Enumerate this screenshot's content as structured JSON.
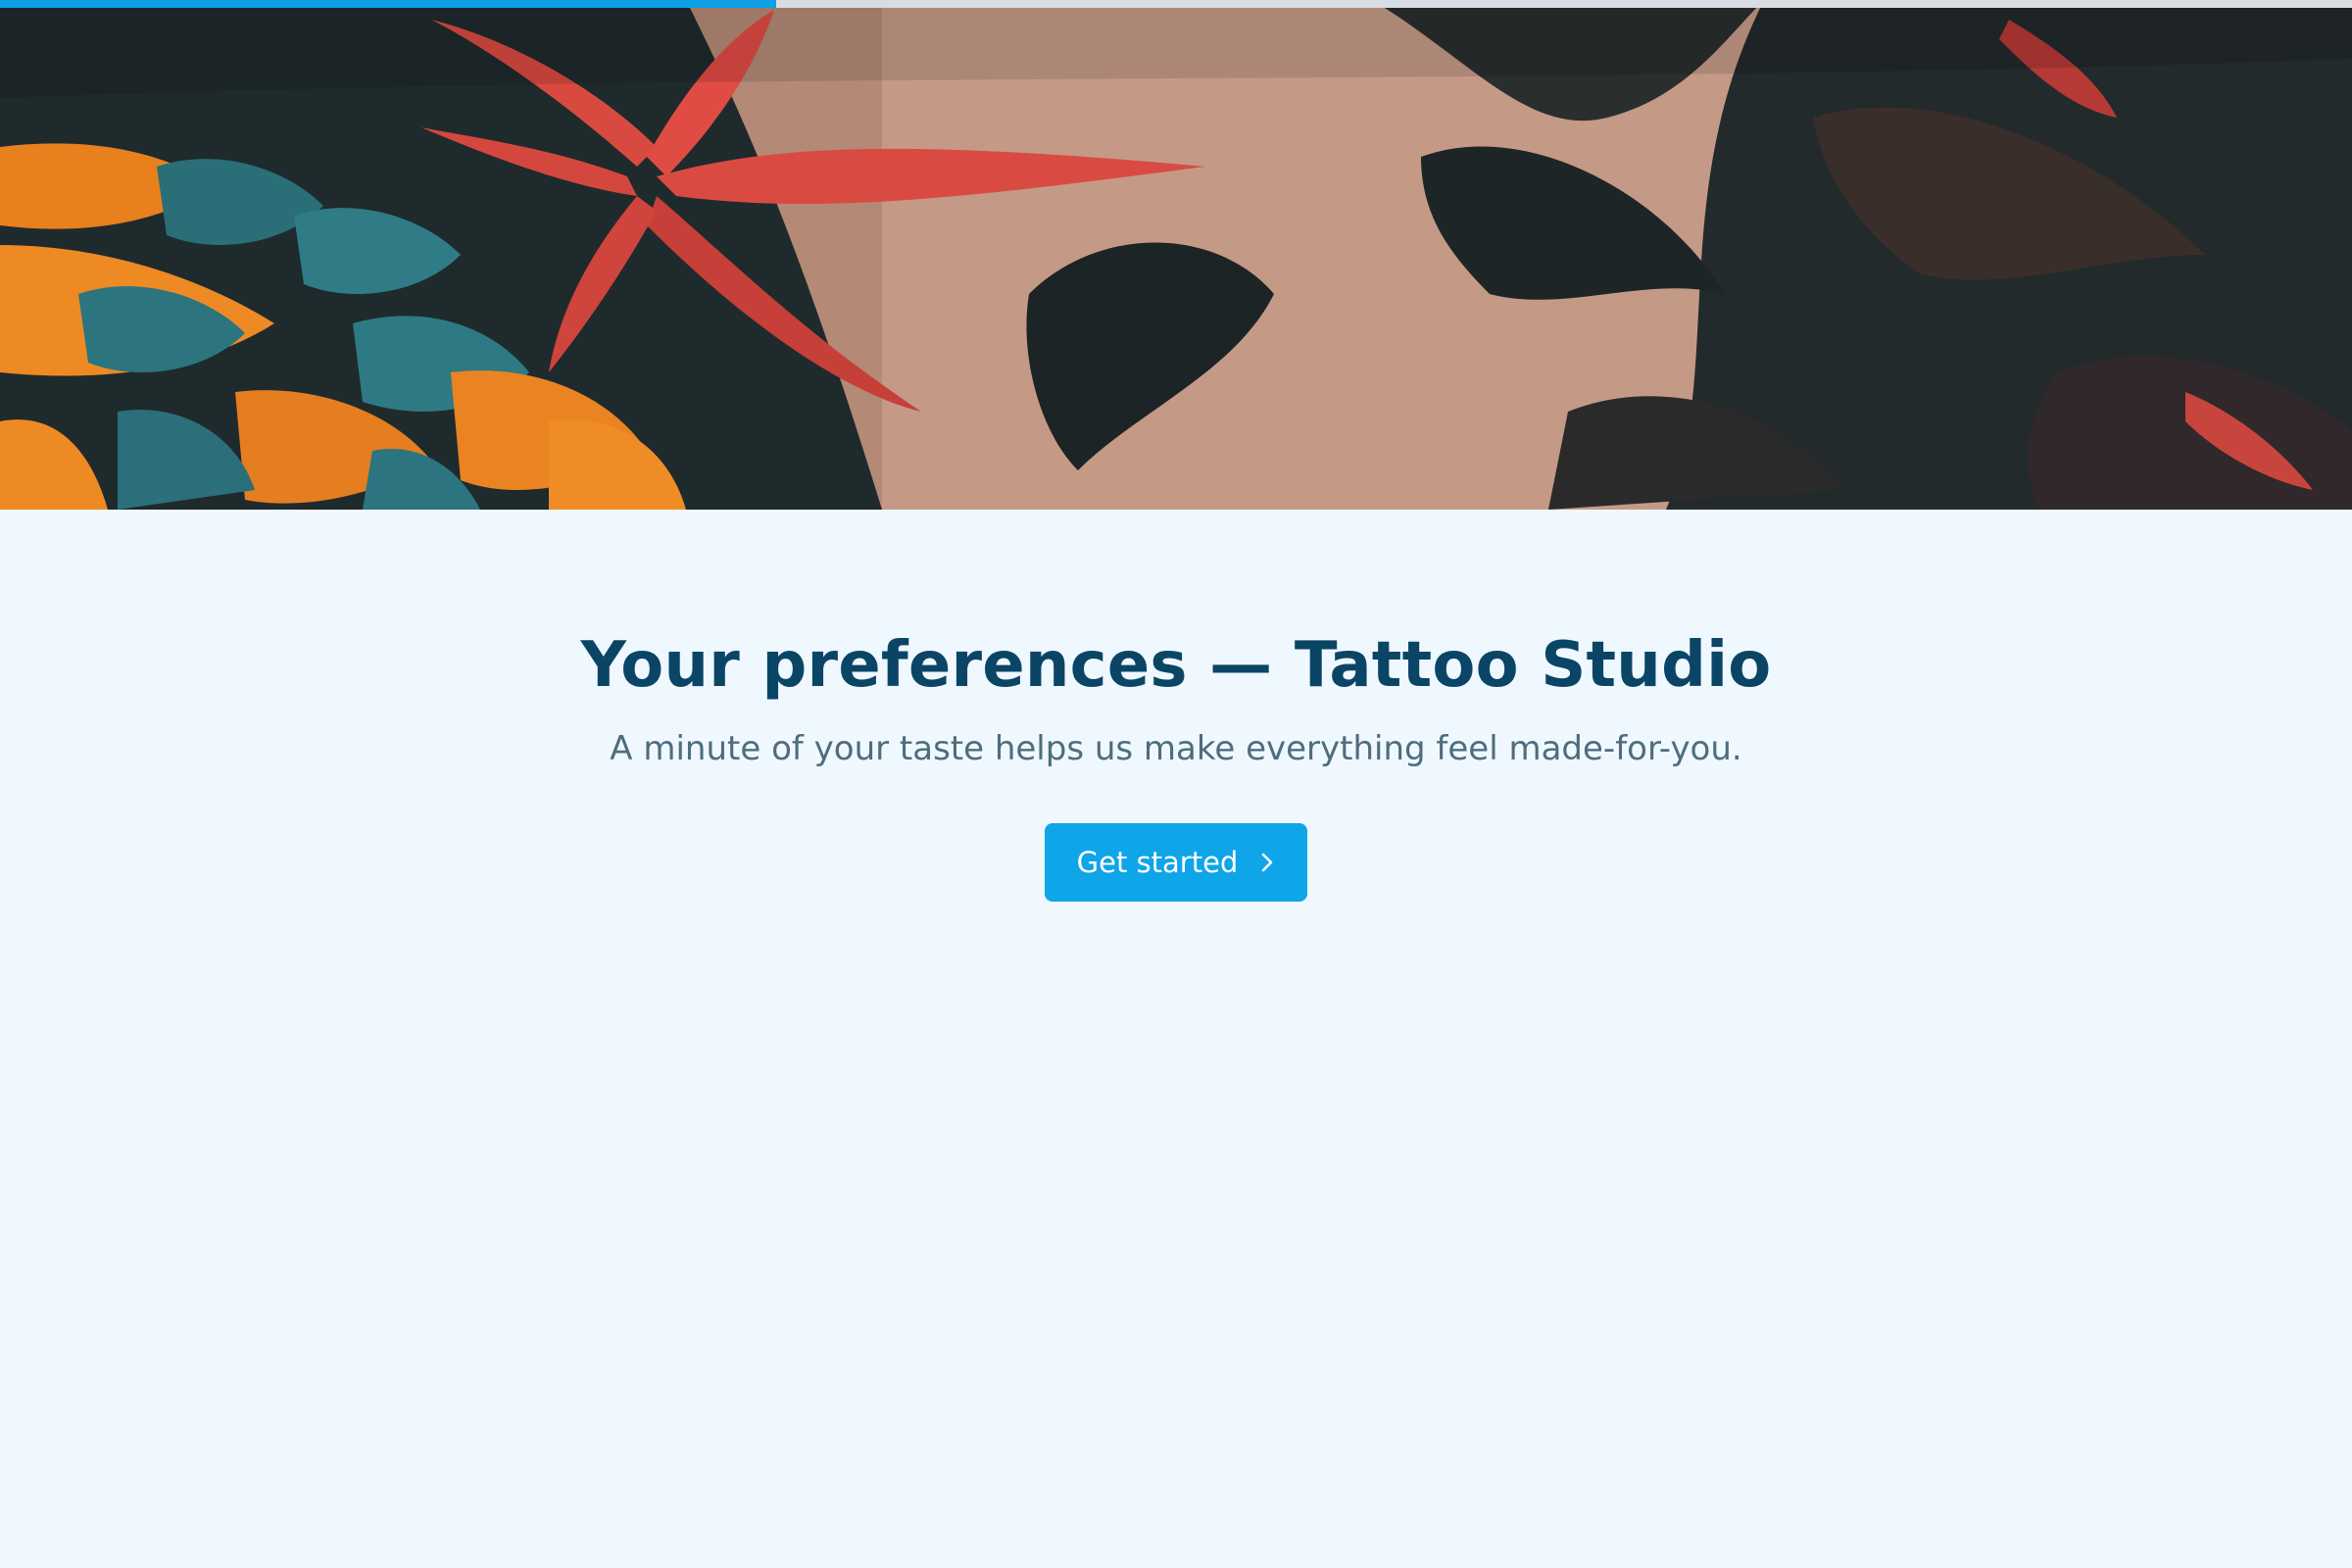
{
  "progress": {
    "fraction": 0.33
  },
  "hero": {
    "image": "tattooed-arm-photo"
  },
  "intro": {
    "title": "Your preferences — Tattoo Studio",
    "subtitle": "A minute of your taste helps us make everything feel made-for-you."
  },
  "cta": {
    "label": "Get started",
    "icon": "chevron-right-icon"
  },
  "colors": {
    "background": "#eff8fe",
    "accent": "#0ea5e9",
    "title": "#0b4566",
    "subtitle": "#4e6d7e"
  }
}
